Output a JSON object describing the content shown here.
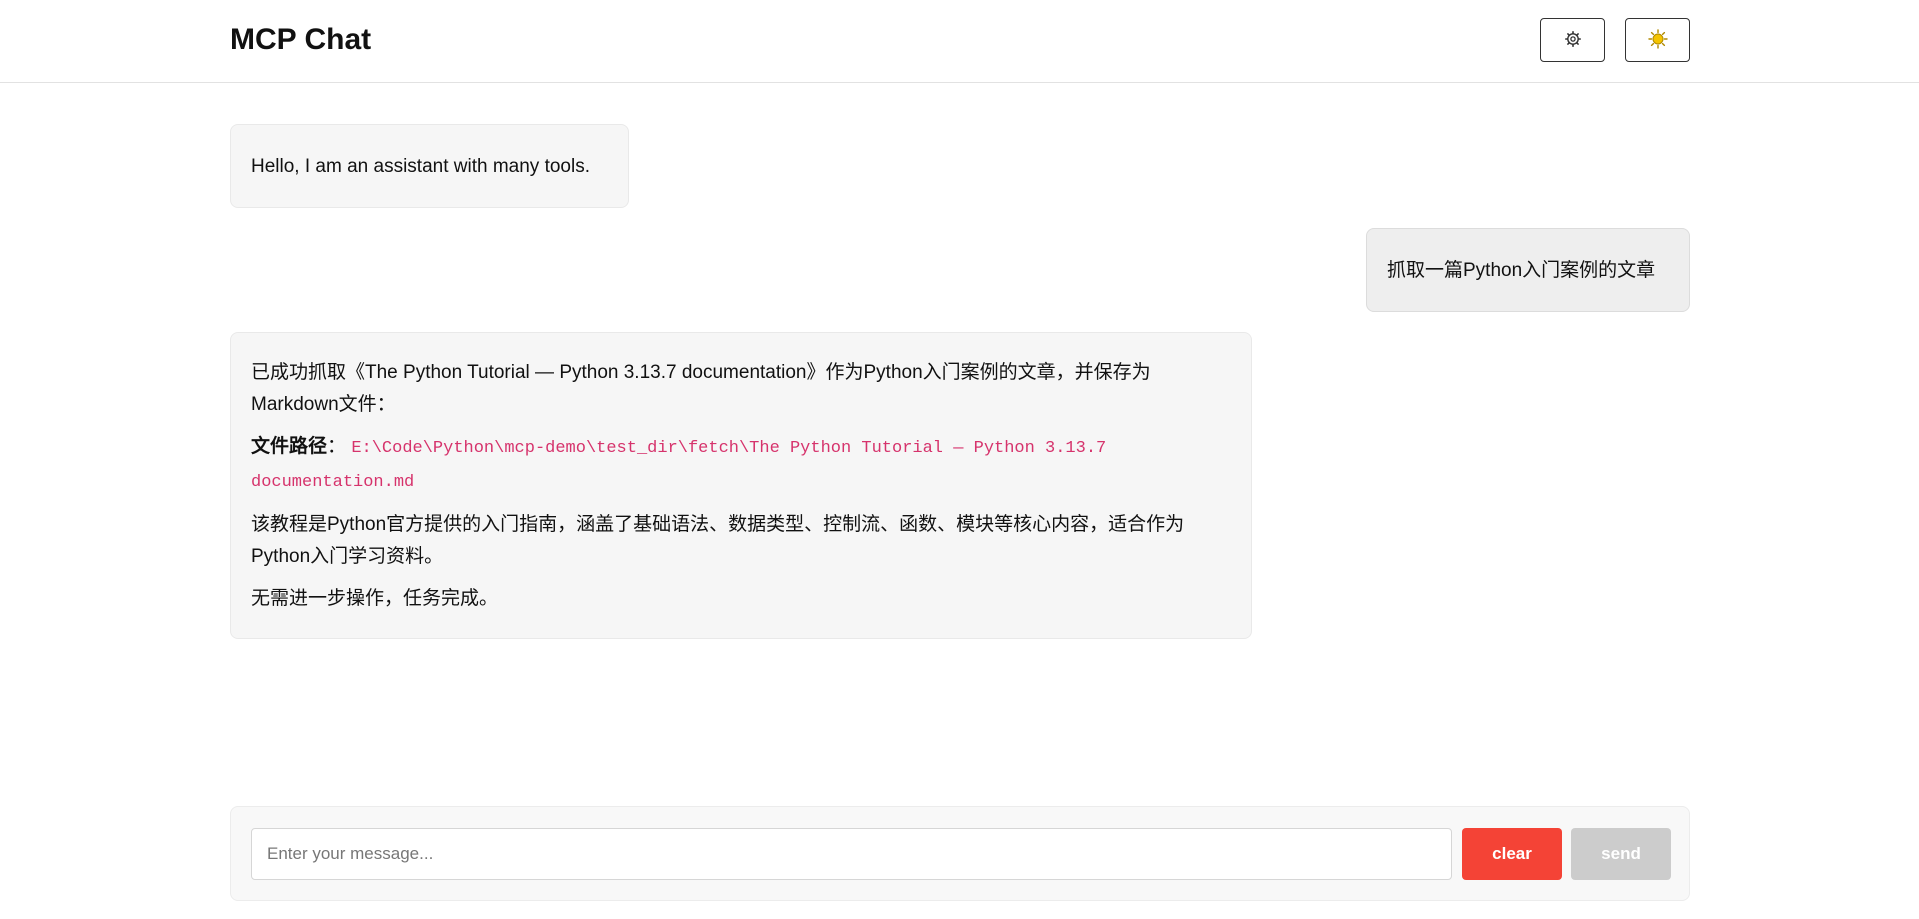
{
  "header": {
    "title": "MCP Chat",
    "settings_icon": "gear-icon",
    "theme_icon": "sun-icon"
  },
  "messages": [
    {
      "role": "assistant",
      "text": "Hello, I am an assistant with many tools."
    },
    {
      "role": "user",
      "text": "抓取一篇Python入门案例的文章"
    },
    {
      "role": "assistant",
      "paragraph_1": "已成功抓取《The Python Tutorial — Python 3.13.7 documentation》作为Python入门案例的文章，并保存为Markdown文件：",
      "path_label": "文件路径",
      "path_colon": "：",
      "path_value": "E:\\Code\\Python\\mcp-demo\\test_dir\\fetch\\The Python Tutorial — Python 3.13.7 documentation.md",
      "paragraph_2": "该教程是Python官方提供的入门指南，涵盖了基础语法、数据类型、控制流、函数、模块等核心内容，适合作为Python入门学习资料。",
      "paragraph_3": "无需进一步操作，任务完成。"
    }
  ],
  "composer": {
    "placeholder": "Enter your message...",
    "value": "",
    "clear_label": "clear",
    "send_label": "send"
  },
  "colors": {
    "clear_button": "#f44336",
    "send_button_disabled": "#cccccc",
    "code_text": "#d6336c",
    "sun_icon": "#f5c400"
  }
}
